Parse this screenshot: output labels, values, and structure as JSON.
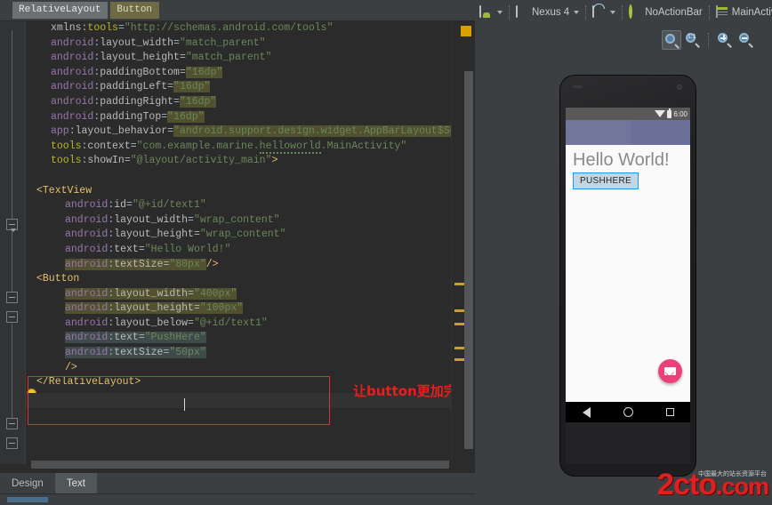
{
  "breadcrumb": {
    "items": [
      {
        "label": "RelativeLayout",
        "style": "layout"
      },
      {
        "label": "Button",
        "style": "button"
      }
    ]
  },
  "editor": {
    "lines": [
      {
        "indent": 1,
        "parts": [
          {
            "t": "xmlns",
            "c": "attrtag"
          },
          {
            "t": ":",
            "c": "punct"
          },
          {
            "t": "tools",
            "c": "ns"
          },
          {
            "t": "=",
            "c": "punct"
          },
          {
            "t": "\"http://schemas.android.com/tools\"",
            "c": "val"
          }
        ]
      },
      {
        "indent": 1,
        "parts": [
          {
            "t": "android",
            "c": "attr"
          },
          {
            "t": ":",
            "c": "punct"
          },
          {
            "t": "layout_width",
            "c": "attrtag"
          },
          {
            "t": "=",
            "c": "punct"
          },
          {
            "t": "\"match_parent\"",
            "c": "val"
          }
        ]
      },
      {
        "indent": 1,
        "parts": [
          {
            "t": "android",
            "c": "attr"
          },
          {
            "t": ":",
            "c": "punct"
          },
          {
            "t": "layout_height",
            "c": "attrtag"
          },
          {
            "t": "=",
            "c": "punct"
          },
          {
            "t": "\"match_parent\"",
            "c": "val"
          }
        ]
      },
      {
        "indent": 1,
        "parts": [
          {
            "t": "android",
            "c": "attr"
          },
          {
            "t": ":",
            "c": "punct"
          },
          {
            "t": "paddingBottom",
            "c": "attrtag"
          },
          {
            "t": "=",
            "c": "punct"
          },
          {
            "t": "\"16dp\"",
            "c": "val hl"
          }
        ]
      },
      {
        "indent": 1,
        "parts": [
          {
            "t": "android",
            "c": "attr"
          },
          {
            "t": ":",
            "c": "punct"
          },
          {
            "t": "paddingLeft",
            "c": "attrtag"
          },
          {
            "t": "=",
            "c": "punct"
          },
          {
            "t": "\"16dp\"",
            "c": "val hl"
          }
        ]
      },
      {
        "indent": 1,
        "parts": [
          {
            "t": "android",
            "c": "attr"
          },
          {
            "t": ":",
            "c": "punct"
          },
          {
            "t": "paddingRight",
            "c": "attrtag"
          },
          {
            "t": "=",
            "c": "punct"
          },
          {
            "t": "\"16dp\"",
            "c": "val hl"
          }
        ]
      },
      {
        "indent": 1,
        "parts": [
          {
            "t": "android",
            "c": "attr"
          },
          {
            "t": ":",
            "c": "punct"
          },
          {
            "t": "paddingTop",
            "c": "attrtag"
          },
          {
            "t": "=",
            "c": "punct"
          },
          {
            "t": "\"16dp\"",
            "c": "val hl"
          }
        ]
      },
      {
        "indent": 1,
        "parts": [
          {
            "t": "app",
            "c": "attr"
          },
          {
            "t": ":",
            "c": "punct"
          },
          {
            "t": "layout_behavior",
            "c": "attrtag"
          },
          {
            "t": "=",
            "c": "punct"
          },
          {
            "t": "\"android.support.design.widget.AppBarLayout$ScrollingVie...\"",
            "c": "val hl"
          }
        ]
      },
      {
        "indent": 1,
        "parts": [
          {
            "t": "tools",
            "c": "ns"
          },
          {
            "t": ":",
            "c": "punct"
          },
          {
            "t": "context",
            "c": "attrtag"
          },
          {
            "t": "=",
            "c": "punct"
          },
          {
            "t": "\"com.example.marine.",
            "c": "val"
          },
          {
            "t": "helloworld",
            "c": "val spell"
          },
          {
            "t": ".MainActivity\"",
            "c": "val"
          }
        ]
      },
      {
        "indent": 1,
        "parts": [
          {
            "t": "tools",
            "c": "ns"
          },
          {
            "t": ":",
            "c": "punct"
          },
          {
            "t": "showIn",
            "c": "attrtag"
          },
          {
            "t": "=",
            "c": "punct"
          },
          {
            "t": "\"@layout/activity_main\"",
            "c": "val"
          },
          {
            "t": ">",
            "c": "tag"
          }
        ]
      },
      {
        "indent": 0,
        "parts": []
      },
      {
        "indent": 0,
        "parts": [
          {
            "t": "<TextView",
            "c": "tag"
          }
        ]
      },
      {
        "indent": 2,
        "parts": [
          {
            "t": "android",
            "c": "attr"
          },
          {
            "t": ":",
            "c": "punct"
          },
          {
            "t": "id",
            "c": "attrtag"
          },
          {
            "t": "=",
            "c": "punct"
          },
          {
            "t": "\"@+id/text1\"",
            "c": "val"
          }
        ]
      },
      {
        "indent": 2,
        "parts": [
          {
            "t": "android",
            "c": "attr"
          },
          {
            "t": ":",
            "c": "punct"
          },
          {
            "t": "layout_width",
            "c": "attrtag"
          },
          {
            "t": "=",
            "c": "punct"
          },
          {
            "t": "\"wrap_content\"",
            "c": "val"
          }
        ]
      },
      {
        "indent": 2,
        "parts": [
          {
            "t": "android",
            "c": "attr"
          },
          {
            "t": ":",
            "c": "punct"
          },
          {
            "t": "layout_height",
            "c": "attrtag"
          },
          {
            "t": "=",
            "c": "punct"
          },
          {
            "t": "\"wrap_content\"",
            "c": "val"
          }
        ]
      },
      {
        "indent": 2,
        "parts": [
          {
            "t": "android",
            "c": "attr"
          },
          {
            "t": ":",
            "c": "punct"
          },
          {
            "t": "text",
            "c": "attrtag"
          },
          {
            "t": "=",
            "c": "punct"
          },
          {
            "t": "\"Hello World!\"",
            "c": "val"
          }
        ]
      },
      {
        "indent": 2,
        "parts": [
          {
            "t": "android",
            "c": "attr hl"
          },
          {
            "t": ":",
            "c": "punct hl"
          },
          {
            "t": "textSize",
            "c": "attrtag hl"
          },
          {
            "t": "=",
            "c": "punct hl"
          },
          {
            "t": "\"80px\"",
            "c": "val hl"
          },
          {
            "t": "/>",
            "c": "tag"
          }
        ]
      },
      {
        "indent": 0,
        "parts": [
          {
            "t": "<Button",
            "c": "tag"
          }
        ]
      },
      {
        "indent": 2,
        "parts": [
          {
            "t": "android",
            "c": "attr hl"
          },
          {
            "t": ":",
            "c": "punct hl"
          },
          {
            "t": "layout_width",
            "c": "attrtag hl"
          },
          {
            "t": "=",
            "c": "punct hl"
          },
          {
            "t": "\"400px\"",
            "c": "val hl"
          }
        ]
      },
      {
        "indent": 2,
        "parts": [
          {
            "t": "android",
            "c": "attr hl"
          },
          {
            "t": ":",
            "c": "punct hl"
          },
          {
            "t": "layout_height",
            "c": "attrtag hl"
          },
          {
            "t": "=",
            "c": "punct hl"
          },
          {
            "t": "\"100px\"",
            "c": "val hl"
          }
        ]
      },
      {
        "indent": 2,
        "parts": [
          {
            "t": "android",
            "c": "attr"
          },
          {
            "t": ":",
            "c": "punct"
          },
          {
            "t": "layout_below",
            "c": "attrtag"
          },
          {
            "t": "=",
            "c": "punct"
          },
          {
            "t": "\"@+id/text1\"",
            "c": "val"
          }
        ]
      },
      {
        "indent": 2,
        "parts": [
          {
            "t": "android",
            "c": "attr hl2"
          },
          {
            "t": ":",
            "c": "punct hl2"
          },
          {
            "t": "text",
            "c": "attrtag hl2"
          },
          {
            "t": "=",
            "c": "punct hl2"
          },
          {
            "t": "\"PushHere\"",
            "c": "val hl2"
          }
        ]
      },
      {
        "indent": 2,
        "parts": [
          {
            "t": "android",
            "c": "attr hl2"
          },
          {
            "t": ":",
            "c": "punct hl2"
          },
          {
            "t": "textSize",
            "c": "attrtag hl2"
          },
          {
            "t": "=",
            "c": "punct hl2"
          },
          {
            "t": "\"50px\"",
            "c": "val hl2"
          }
        ]
      },
      {
        "indent": 2,
        "parts": [
          {
            "t": "/>",
            "c": "tag"
          }
        ]
      },
      {
        "indent": 0,
        "parts": [
          {
            "t": "</RelativeLayout>",
            "c": "tag"
          }
        ]
      }
    ]
  },
  "annotation": {
    "text": "让button更加完善",
    "color": "#e81e1e"
  },
  "bottom_tabs": [
    {
      "label": "Design",
      "active": false
    },
    {
      "label": "Text",
      "active": true
    }
  ],
  "preview_toolbar": {
    "items": [
      {
        "icon": "device-android-icon",
        "label": "",
        "dropdown": true
      },
      {
        "icon": "nexus-device-icon",
        "label": "Nexus 4",
        "dropdown": true
      },
      {
        "icon": "orientation-icon",
        "label": "",
        "dropdown": true
      },
      {
        "icon": "theme-icon",
        "label": "NoActionBar",
        "dropdown": false
      },
      {
        "icon": "activity-icon",
        "label": "MainActivity",
        "dropdown": false
      }
    ]
  },
  "zoom_controls": [
    {
      "name": "zoom-fit-button",
      "glyph": "",
      "selected": true
    },
    {
      "name": "zoom-actual-size-button",
      "glyph": "1:1",
      "selected": false
    },
    {
      "name": "zoom-in-button",
      "glyph": "+",
      "selected": false
    },
    {
      "name": "zoom-out-button",
      "glyph": "-",
      "selected": false
    }
  ],
  "device_preview": {
    "status_bar": {
      "clock": "6:00"
    },
    "hello_text": "Hello World!",
    "button_text": "PUSHHERE",
    "fab": {
      "icon": "envelope-icon",
      "color": "#ec407a"
    },
    "nav_bar": [
      "back-icon",
      "home-icon",
      "recents-icon"
    ]
  },
  "watermark": {
    "text": "2cto",
    "domain": ".com",
    "sub": "中国最大的站长资源平台"
  }
}
